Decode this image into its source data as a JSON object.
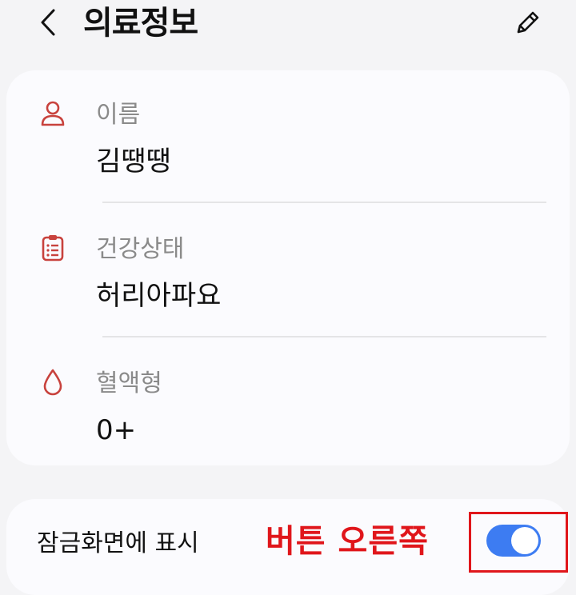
{
  "header": {
    "title": "의료정보",
    "back_icon": "chevron-left-icon",
    "edit_icon": "pencil-icon"
  },
  "fields": [
    {
      "icon": "person-icon",
      "label": "이름",
      "value": "김땡땡"
    },
    {
      "icon": "clipboard-icon",
      "label": "건강상태",
      "value": "허리아파요"
    },
    {
      "icon": "blood-drop-icon",
      "label": "혈액형",
      "value": "0+"
    }
  ],
  "lockscreen": {
    "label": "잠금화면에 표시",
    "toggle_on": true,
    "annotation": "버튼 오른쪽"
  },
  "colors": {
    "icon_red": "#c8423d",
    "toggle_blue": "#3d7cf2",
    "annotation_red": "#e0161b",
    "card_bg": "#fbfbfe",
    "page_bg": "#f4f4f6"
  }
}
